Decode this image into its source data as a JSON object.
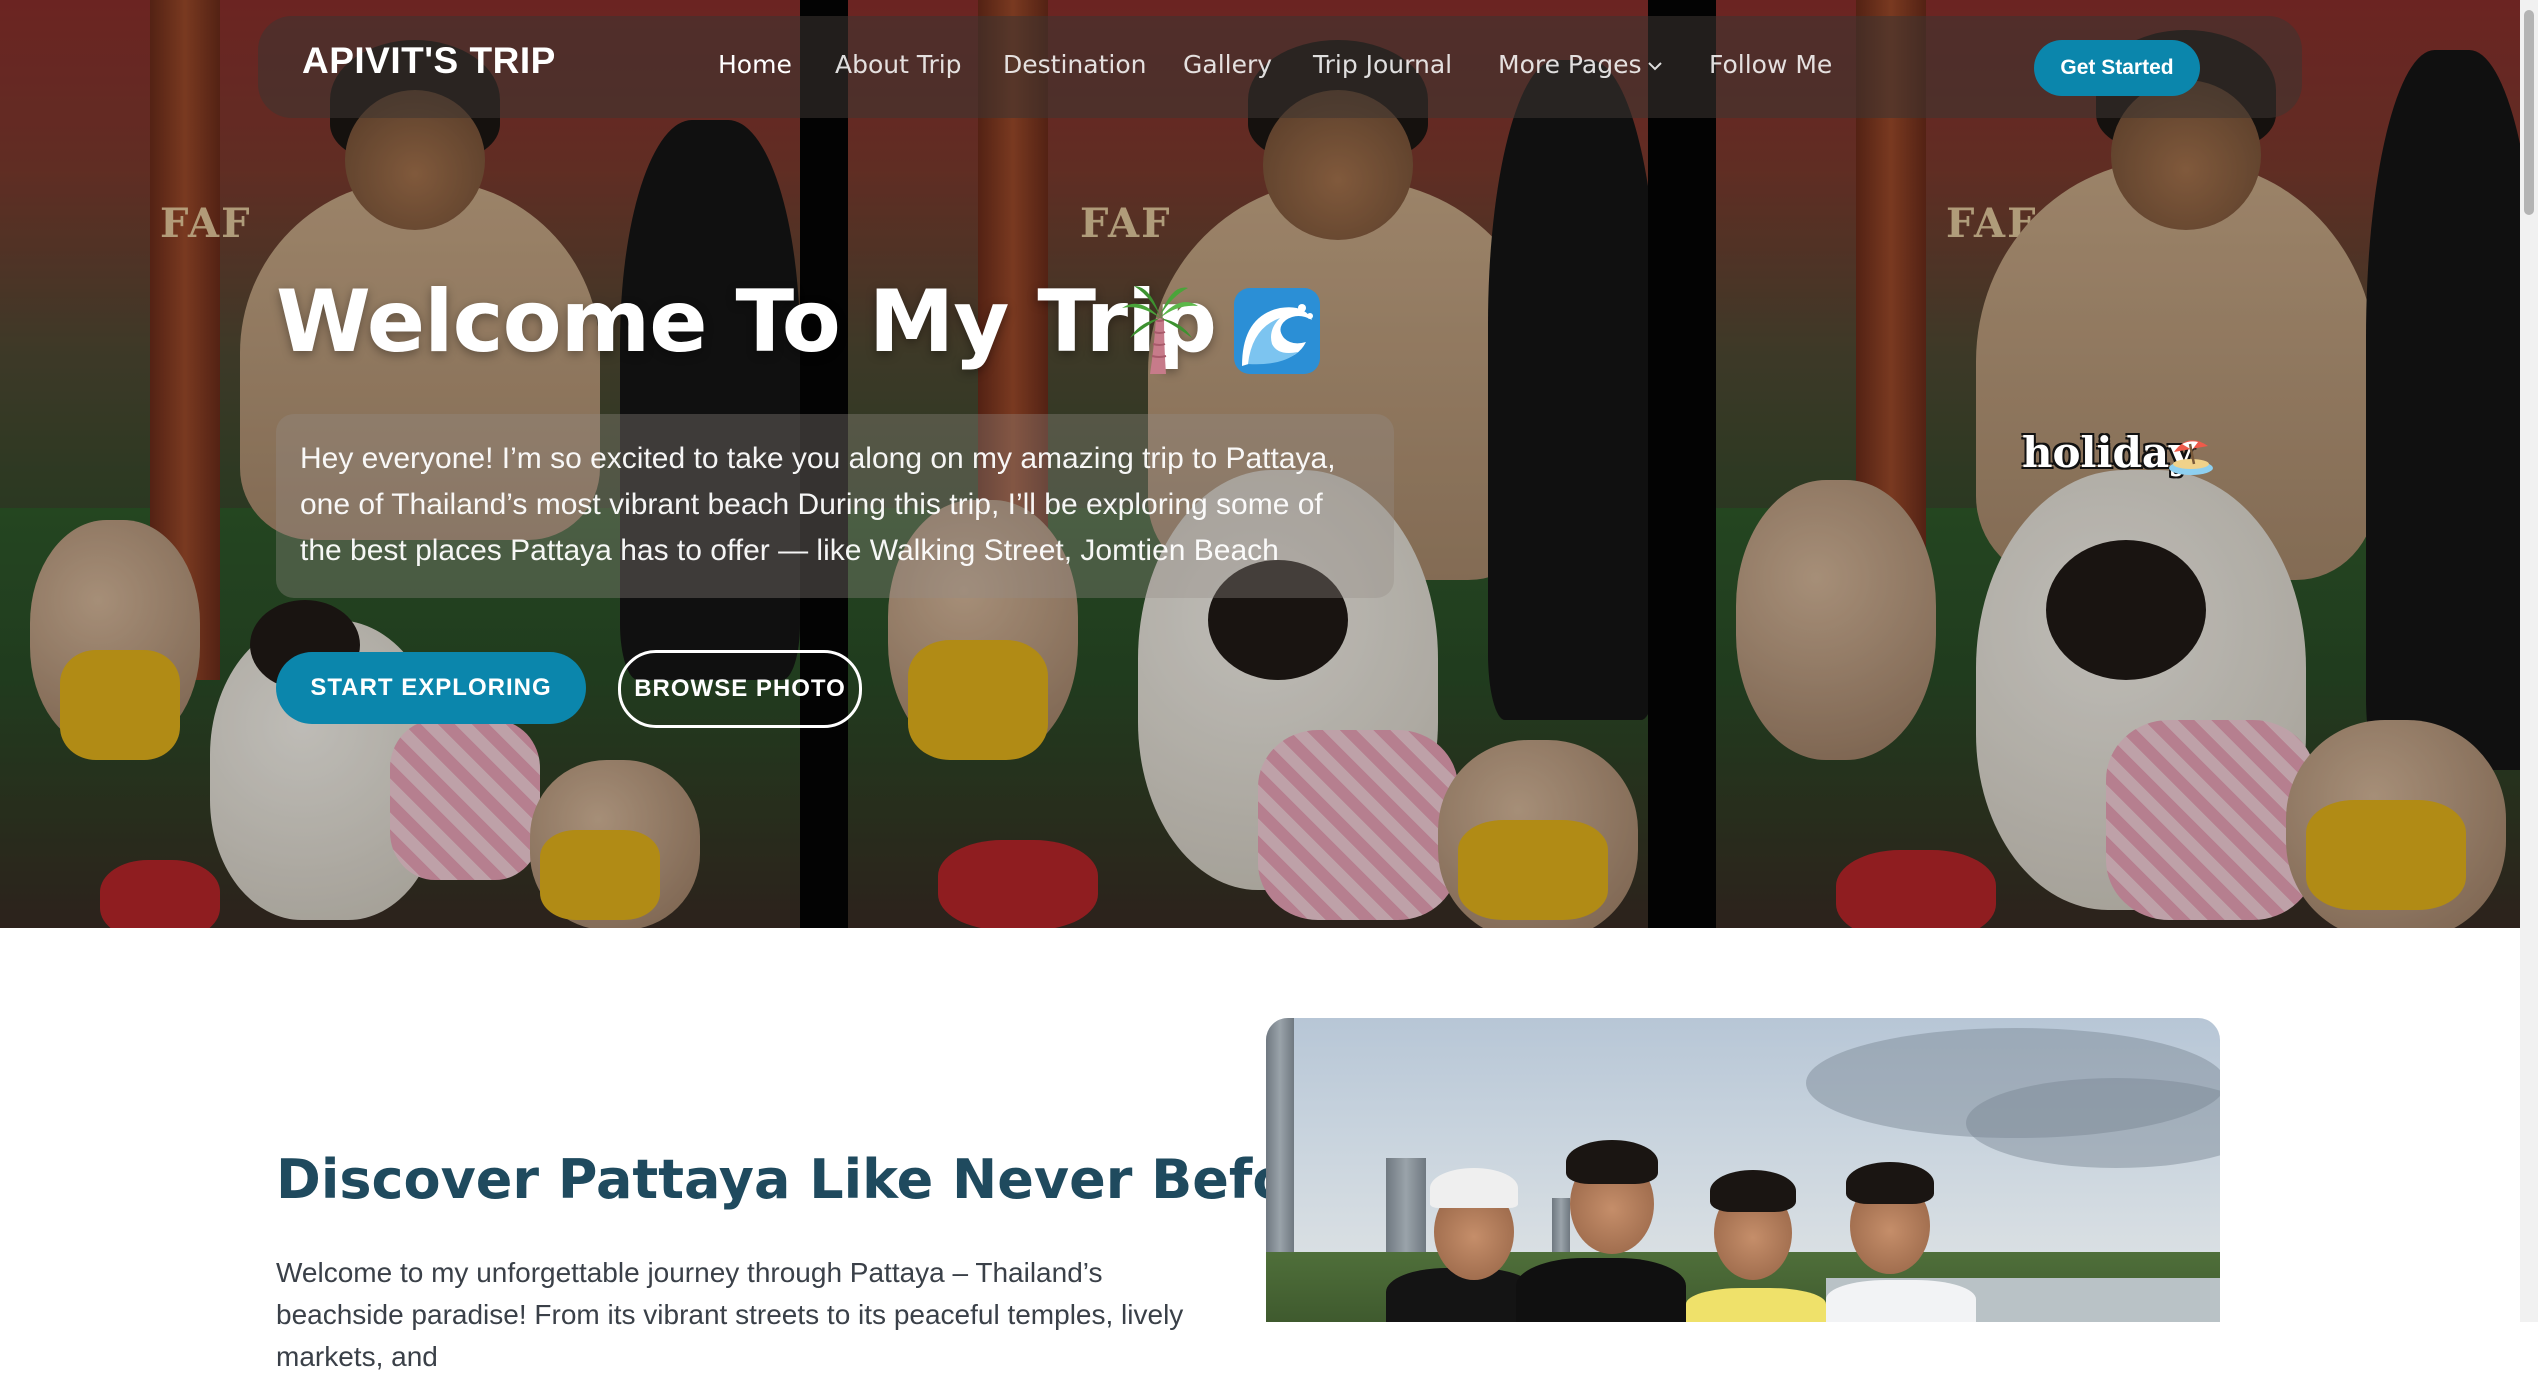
{
  "brand": "APIVIT'S TRIP",
  "nav": {
    "links": [
      {
        "label": "Home",
        "active": true
      },
      {
        "label": "About Trip",
        "active": false
      },
      {
        "label": "Destination",
        "active": false
      },
      {
        "label": "Gallery",
        "active": false
      },
      {
        "label": "Trip Journal",
        "active": false
      },
      {
        "label": "More Pages",
        "active": false,
        "has_dropdown": true
      },
      {
        "label": "Follow Me",
        "active": false
      }
    ],
    "cta_label": "Get Started"
  },
  "hero": {
    "title": "Welcome To My Trip",
    "title_icons": [
      "palm-tree-icon",
      "wave-icon"
    ],
    "description": "Hey everyone! I’m so excited to take you along on my amazing trip to Pattaya, one of Thailand’s most vibrant beach During this trip, I’ll be exploring some of the best places Pattaya has to offer — like Walking Street, Jomtien Beach",
    "primary_button": "START EXPLORING",
    "secondary_button": "BROWSE PHOTO",
    "video_caption": "holiday",
    "video_caption_icon": "beach-umbrella-icon"
  },
  "about": {
    "title": "Discover Pattaya Like Never Before",
    "text": "Welcome to my unforgettable journey through Pattaya – Thailand’s beachside paradise! From its vibrant streets to its peaceful temples, lively markets, and"
  },
  "colors": {
    "accent": "#0b86ac",
    "heading": "#1f4a5e",
    "body_text": "#3a4048",
    "nav_bg": "rgba(60,52,50,0.55)"
  }
}
